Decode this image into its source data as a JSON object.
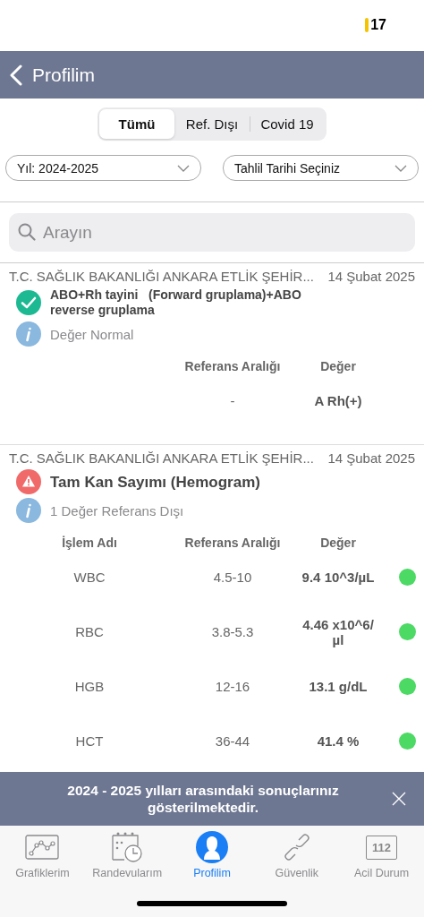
{
  "status_bar": {
    "battery": "17"
  },
  "header": {
    "title": "Profilim"
  },
  "segments": [
    {
      "label": "Tümü",
      "selected": true
    },
    {
      "label": "Ref. Dışı",
      "selected": false
    },
    {
      "label": "Covid 19",
      "selected": false
    }
  ],
  "filters": [
    {
      "value": "Yıl: 2024-2025"
    },
    {
      "value": "Tahlil Tarihi Seçiniz"
    }
  ],
  "search": {
    "placeholder": "Arayın"
  },
  "results": [
    {
      "institution": "T.C. SAĞLIK BAKANLIĞI ANKARA ETLİK ŞEHİR...",
      "date": "14 Şubat 2025",
      "kind": "normal",
      "title": "ABO+Rh tayini   (Forward gruplama)+ABO reverse gruplama",
      "summary": "Değer Normal",
      "columns": [
        "Referans Aralığı",
        "Değer"
      ],
      "rows": [
        {
          "reference": "-",
          "value": "A Rh(+)"
        }
      ]
    },
    {
      "institution": "T.C. SAĞLIK BAKANLIĞI ANKARA ETLİK ŞEHİR...",
      "date": "14 Şubat 2025",
      "kind": "abnormal",
      "title": "Tam Kan Sayımı (Hemogram)",
      "summary": "1 Değer Referans Dışı",
      "columns": [
        "İşlem Adı",
        "Referans Aralığı",
        "Değer"
      ],
      "rows": [
        {
          "name": "WBC",
          "reference": "4.5-10",
          "value": "9.4 10^3/µL",
          "color": "#4cd964"
        },
        {
          "name": "RBC",
          "reference": "3.8-5.3",
          "value": "4.46 x10^6/µl",
          "color": "#4cd964"
        },
        {
          "name": "HGB",
          "reference": "12-16",
          "value": "13.1 g/dL",
          "color": "#4cd964"
        },
        {
          "name": "HCT",
          "reference": "36-44",
          "value": "41.4 %",
          "color": "#4cd964"
        }
      ]
    }
  ],
  "banner": {
    "text": "2024 - 2025 yılları arasındaki sonuçlarınız gösterilmektedir."
  },
  "tab_bar": [
    {
      "kind": "chart",
      "label": "Grafiklerim",
      "selected": false
    },
    {
      "kind": "calendar",
      "label": "Randevularım",
      "selected": false
    },
    {
      "kind": "person",
      "label": "Profilim",
      "selected": true
    },
    {
      "kind": "link",
      "label": "Güvenlik",
      "selected": false
    },
    {
      "kind": "emergency",
      "badge": "112",
      "label": "Acil Durum",
      "selected": false
    }
  ]
}
